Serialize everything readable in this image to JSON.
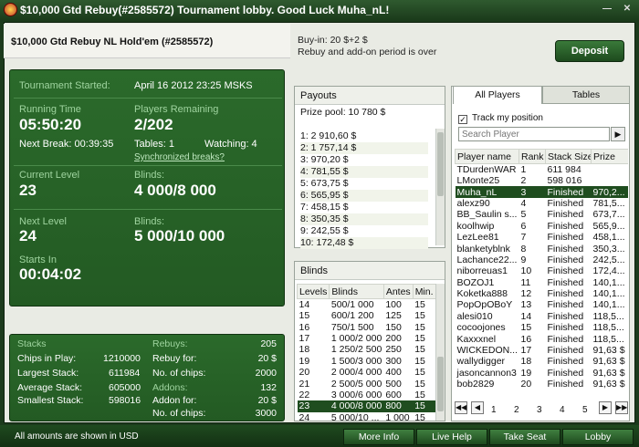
{
  "window": {
    "title": "$10,000 Gtd Rebuy(#2585572) Tournament lobby. Good Luck Muha_nL!"
  },
  "header": {
    "tournament_name": "$10,000 Gtd Rebuy NL Hold'em (#2585572)",
    "buyin_line": "Buy-in: 20 $+2 $",
    "rebuy_line": "Rebuy and add-on period is over",
    "deposit_label": "Deposit"
  },
  "info": {
    "started_label": "Tournament Started:",
    "started_value": "April 16 2012  23:25 MSKS",
    "running_label": "Running Time",
    "running_value": "05:50:20",
    "remaining_label": "Players Remaining",
    "remaining_value": "2/202",
    "next_break": "Next Break: 00:39:35",
    "tables": "Tables: 1",
    "watching": "Watching: 4",
    "sync_link": "Synchronized breaks?",
    "current_level_label": "Current Level",
    "current_level_value": "23",
    "blinds_label": "Blinds:",
    "blinds_value": "4 000/8 000",
    "next_level_label": "Next Level",
    "next_level_value": "24",
    "next_blinds_label": "Blinds:",
    "next_blinds_value": "5 000/10 000",
    "starts_in_label": "Starts In",
    "starts_in_value": "00:04:02"
  },
  "stats": {
    "stacks_label": "Stacks",
    "rebuys_label": "Rebuys:",
    "rebuys_value": "205",
    "chips_label": "Chips in Play:",
    "chips_value": "1210000",
    "rebuy_for_label": "Rebuy for:",
    "rebuy_for_value": "20 $",
    "largest_label": "Largest Stack:",
    "largest_value": "611984",
    "nchips_label": "No. of chips:",
    "nchips_value": "2000",
    "average_label": "Average Stack:",
    "average_value": "605000",
    "addons_label": "Addons:",
    "addons_value": "132",
    "smallest_label": "Smallest Stack:",
    "smallest_value": "598016",
    "addon_for_label": "Addon for:",
    "addon_for_value": "20 $",
    "nchips2_label": "No. of chips:",
    "nchips2_value": "3000"
  },
  "payouts": {
    "title": "Payouts",
    "prize_pool": "Prize pool: 10 780 $",
    "items": [
      "1: 2 910,60 $",
      "2: 1 757,14 $",
      "3: 970,20 $",
      "4: 781,55 $",
      "5: 673,75 $",
      "6: 565,95 $",
      "7: 458,15 $",
      "8: 350,35 $",
      "9: 242,55 $",
      "10: 172,48 $"
    ]
  },
  "blinds": {
    "title": "Blinds",
    "columns": [
      "Levels",
      "Blinds",
      "Antes",
      "Min."
    ],
    "rows": [
      [
        "14",
        "500/1 000",
        "100",
        "15"
      ],
      [
        "15",
        "600/1 200",
        "125",
        "15"
      ],
      [
        "16",
        "750/1 500",
        "150",
        "15"
      ],
      [
        "17",
        "1 000/2 000",
        "200",
        "15"
      ],
      [
        "18",
        "1 250/2 500",
        "250",
        "15"
      ],
      [
        "19",
        "1 500/3 000",
        "300",
        "15"
      ],
      [
        "20",
        "2 000/4 000",
        "400",
        "15"
      ],
      [
        "21",
        "2 500/5 000",
        "500",
        "15"
      ],
      [
        "22",
        "3 000/6 000",
        "600",
        "15"
      ],
      [
        "23",
        "4 000/8 000",
        "800",
        "15"
      ],
      [
        "24",
        "5 000/10 ...",
        "1 000",
        "15"
      ]
    ],
    "selected_index": 9
  },
  "players": {
    "tab_all": "All Players",
    "tab_tables": "Tables",
    "track_label": "Track my position",
    "search_placeholder": "Search Player",
    "search_btn": "▶",
    "columns": [
      "Player name",
      "Rank",
      "Stack Size",
      "Prize"
    ],
    "rows": [
      [
        "TDurdenWAR",
        "1",
        "611 984",
        ""
      ],
      [
        "LMonte25",
        "2",
        "598 016",
        ""
      ],
      [
        "Muha_nL",
        "3",
        "Finished",
        "970,2..."
      ],
      [
        "alexz90",
        "4",
        "Finished",
        "781,5..."
      ],
      [
        "BB_Saulin s...",
        "5",
        "Finished",
        "673,7..."
      ],
      [
        "koolhwip",
        "6",
        "Finished",
        "565,9..."
      ],
      [
        "LezLee81",
        "7",
        "Finished",
        "458,1..."
      ],
      [
        "blanketyblnk",
        "8",
        "Finished",
        "350,3..."
      ],
      [
        "Lachance22...",
        "9",
        "Finished",
        "242,5..."
      ],
      [
        "niborreuas1",
        "10",
        "Finished",
        "172,4..."
      ],
      [
        "BOZOJ1",
        "11",
        "Finished",
        "140,1..."
      ],
      [
        "Koketka888",
        "12",
        "Finished",
        "140,1..."
      ],
      [
        "PopOpOBoY",
        "13",
        "Finished",
        "140,1..."
      ],
      [
        "alesi010",
        "14",
        "Finished",
        "118,5..."
      ],
      [
        "cocoojones",
        "15",
        "Finished",
        "118,5..."
      ],
      [
        "Kaxxxnel",
        "16",
        "Finished",
        "118,5..."
      ],
      [
        "WICKEDON...",
        "17",
        "Finished",
        "91,63 $"
      ],
      [
        "wallydigger",
        "18",
        "Finished",
        "91,63 $"
      ],
      [
        "jasoncannon3",
        "19",
        "Finished",
        "91,63 $"
      ],
      [
        "bob2829",
        "20",
        "Finished",
        "91,63 $"
      ]
    ],
    "selected_index": 2,
    "pages": [
      "1",
      "2",
      "3",
      "4",
      "5"
    ]
  },
  "footer": {
    "note": "All amounts are shown in USD",
    "buttons": [
      "More Info",
      "Live Help",
      "Take Seat",
      "Lobby"
    ]
  }
}
